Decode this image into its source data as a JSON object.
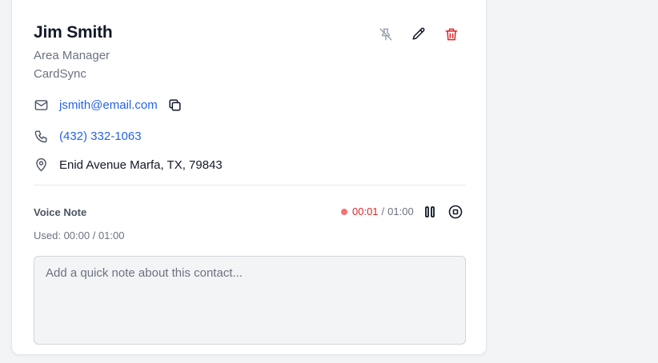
{
  "contact": {
    "name": "Jim Smith",
    "title": "Area Manager",
    "company": "CardSync",
    "email": "jsmith@email.com",
    "phone": "(432) 332-1063",
    "address": "Enid Avenue Marfa, TX, 79843"
  },
  "actions": {
    "icons": [
      "unpin-icon",
      "edit-icon",
      "delete-icon"
    ]
  },
  "voice_note": {
    "title": "Voice Note",
    "elapsed": "00:01",
    "separator": "/",
    "total": "01:00",
    "used_label": "Used: 00:00 / 01:00"
  },
  "note": {
    "placeholder": "Add a quick note about this contact...",
    "value": ""
  },
  "colors": {
    "link": "#2563eb",
    "delete": "#dc2626",
    "recording": "#f87171"
  }
}
